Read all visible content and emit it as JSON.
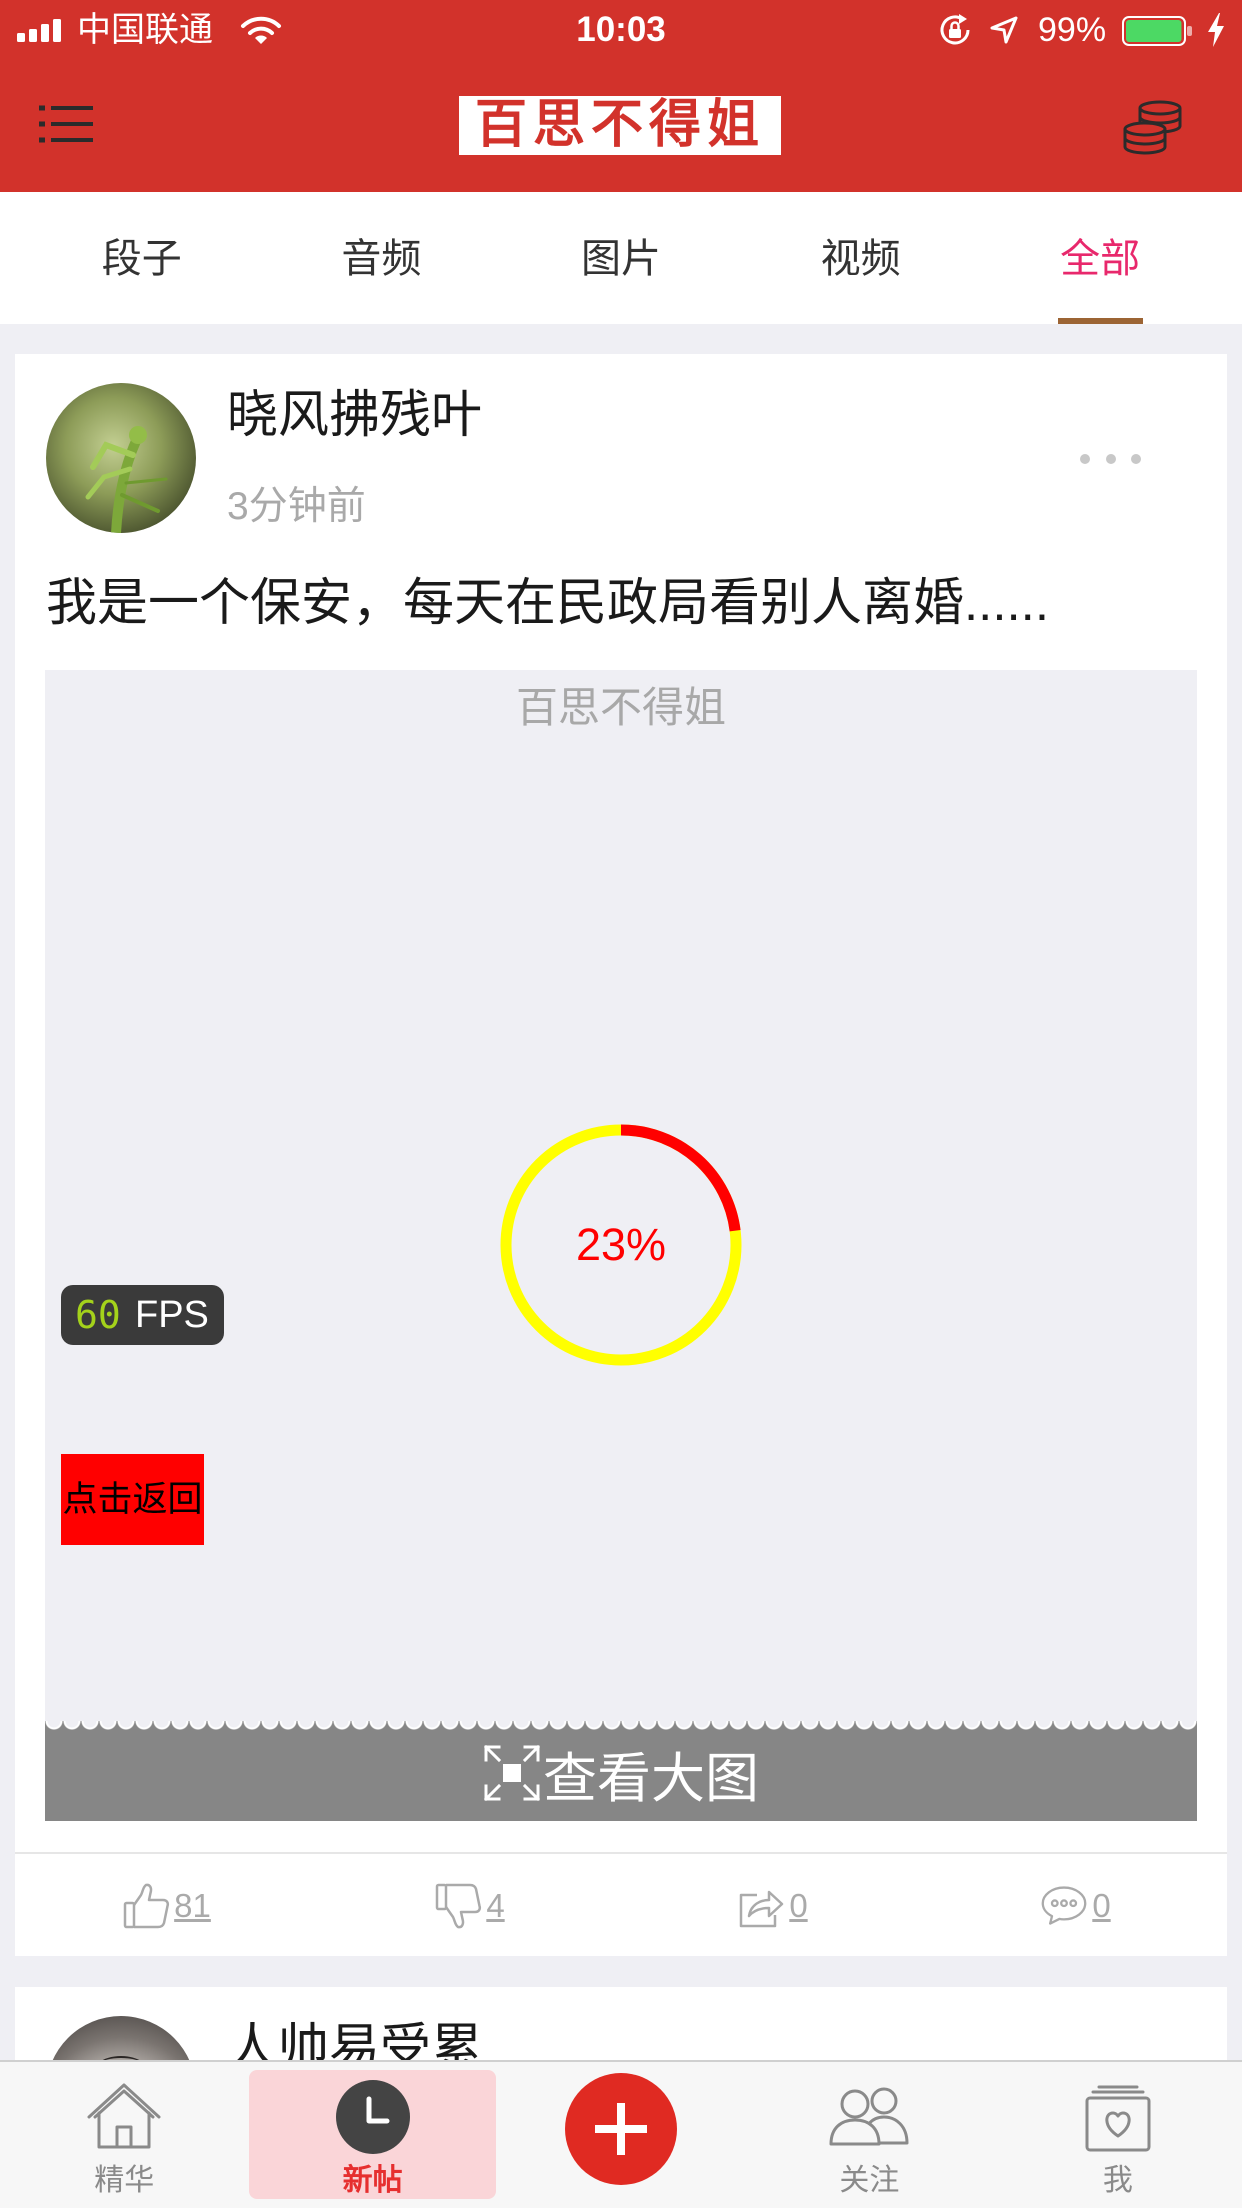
{
  "status_bar": {
    "carrier": "中国联通",
    "time": "10:03",
    "battery_text": "99%",
    "battery_level": 0.99,
    "icons": [
      "signal-icon",
      "wifi-icon",
      "rotation-lock-icon",
      "location-icon",
      "battery-icon",
      "charging-icon"
    ]
  },
  "nav": {
    "logo": "百思不得姐",
    "left_icon": "list-menu-icon",
    "right_icon": "coins-icon"
  },
  "tabs": [
    {
      "label": "段子",
      "active": false
    },
    {
      "label": "音频",
      "active": false
    },
    {
      "label": "图片",
      "active": false
    },
    {
      "label": "视频",
      "active": false
    },
    {
      "label": "全部",
      "active": true
    }
  ],
  "posts": [
    {
      "author": "晓风拂残叶",
      "time": "3分钟前",
      "text": "我是一个保安，每天在民政局看别人离婚......",
      "media": {
        "watermark": "百思不得姐",
        "progress": 0.23,
        "progress_label": "23%",
        "view_full_label": "查看大图"
      },
      "actions": {
        "like_count": "81",
        "dislike_count": "4",
        "share_count": "0",
        "comment_count": "0"
      }
    },
    {
      "author": "人帅易受累"
    }
  ],
  "overlays": {
    "fps_value": "60",
    "fps_unit": "FPS",
    "back_button": "点击返回"
  },
  "tab_bar": [
    {
      "label": "精华",
      "icon": "home-icon",
      "active": false
    },
    {
      "label": "新帖",
      "icon": "clock-icon",
      "active": true
    },
    {
      "icon": "plus-icon",
      "active": false
    },
    {
      "label": "关注",
      "icon": "friends-icon",
      "active": false
    },
    {
      "label": "我",
      "icon": "profile-icon",
      "active": false
    }
  ],
  "colors": {
    "header": "#d2322b",
    "active_tab": "#e8286c",
    "tab_indicator": "#9c6434",
    "progress_done": "#ff0000",
    "progress_remaining": "#ffff00",
    "plus_button": "#e02a22",
    "active_tabbar_label": "#e62f2f",
    "active_tabbar_bg": "#fad5d8",
    "fps_value": "#a4d21b",
    "battery": "#4cd964"
  }
}
